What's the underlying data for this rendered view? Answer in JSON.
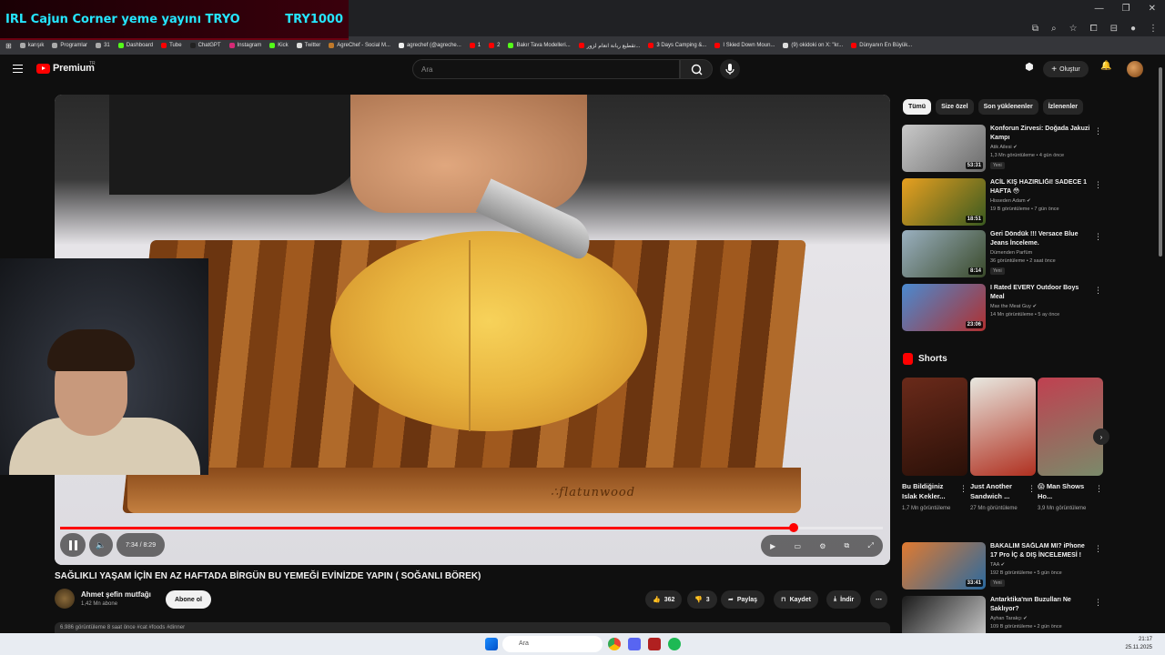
{
  "stream": {
    "left": "IRL Cajun Corner yeme yayını  TRYO",
    "right": "TRY1000"
  },
  "bookmarks": [
    {
      "label": "karışık",
      "color": "#aaa"
    },
    {
      "label": "Programlar",
      "color": "#aaa"
    },
    {
      "label": "31",
      "color": "#aaa"
    },
    {
      "label": "Dashboard",
      "color": "#53fc18"
    },
    {
      "label": "Tube",
      "color": "#f00"
    },
    {
      "label": "ChatGPT",
      "color": "#222"
    },
    {
      "label": "Instagram",
      "color": "#d62976"
    },
    {
      "label": "Kick",
      "color": "#53fc18"
    },
    {
      "label": "Twitter",
      "color": "#ddd"
    },
    {
      "label": "AgreChef - Social M...",
      "color": "#c0792a"
    },
    {
      "label": "agrechef (@agreche...",
      "color": "#eee"
    },
    {
      "label": "1",
      "color": "#f00"
    },
    {
      "label": "2",
      "color": "#f00"
    },
    {
      "label": "Bakır Tava Modelleri...",
      "color": "#53fc18"
    },
    {
      "label": "تقطيع ربانة انعام لزور...",
      "color": "#f00"
    },
    {
      "label": "3 Days Camping &...",
      "color": "#f00"
    },
    {
      "label": "I Skied Down Moun...",
      "color": "#f00"
    },
    {
      "label": "(9) okidoki on X: \"kr...",
      "color": "#ddd"
    },
    {
      "label": "Dünyanın En Büyük...",
      "color": "#f00"
    }
  ],
  "header": {
    "logo": "Premium",
    "region": "TR",
    "search_placeholder": "Ara",
    "create": "Oluştur"
  },
  "player": {
    "time": "7:34 / 8:29",
    "progress": 0.892,
    "brand": "∴flatunwood"
  },
  "video": {
    "title": "SAĞLIKLI YAŞAM İÇİN EN AZ HAFTADA BİRGÜN BU YEMEĞİ EVİNİZDE YAPIN ( SOĞANLI BÖREK)",
    "channel": "Ahmet şefin mutfağı",
    "subs": "1,42 Mn abone",
    "subscribe": "Abone ol",
    "likes": "362",
    "dislikes": "3",
    "share": "Paylaş",
    "save": "Kaydet",
    "download": "İndir",
    "desc": "6.986 görüntüleme  8 saat önce  #cat #foods #dinner"
  },
  "chips": [
    "Tümü",
    "Size özel",
    "Son yüklenenler",
    "İzlenenler"
  ],
  "recommended": [
    {
      "title": "Konforun Zirvesi: Doğada Jakuzi Kampı",
      "channel": "Atik Ailesi ✔",
      "meta": "1,3 Mn görüntüleme • 4 gün önce",
      "badge": "Yeni",
      "dur": "53:31",
      "color1": "#c9c9c9",
      "color2": "#6b6b6b"
    },
    {
      "title": "ACİL KIŞ HAZIRLIĞI! SADECE 1 HAFTA 😳",
      "channel": "Hisseden Adam ✔",
      "meta": "19 B görüntüleme • 7 gün önce",
      "badge": "",
      "dur": "18:51",
      "color1": "#e8a020",
      "color2": "#3a5a20"
    },
    {
      "title": "Geri Döndük !!! Versace Blue Jeans İnceleme.",
      "channel": "Dümenden Parfüm",
      "meta": "36 görüntüleme • 2 saat önce",
      "badge": "Yeni",
      "dur": "8:14",
      "color1": "#9ab0c0",
      "color2": "#3a4a2a"
    },
    {
      "title": "I Rated EVERY Outdoor Boys Meal",
      "channel": "Max the Meat Guy ✔",
      "meta": "14 Mn görüntüleme • 5 ay önce",
      "badge": "",
      "dur": "23:06",
      "color1": "#4a8ad0",
      "color2": "#b03030"
    },
    {
      "title": "BAKALIM SAĞLAM MI? iPhone 17 Pro İÇ & DIŞ İNCELEMESİ !",
      "channel": "TAA ✔",
      "meta": "192 B görüntüleme • 5 gün önce",
      "badge": "Yeni",
      "dur": "33:41",
      "color1": "#e07a30",
      "color2": "#2a6aa0"
    },
    {
      "title": "Antarktika'nın Buzulları Ne Saklıyor?",
      "channel": "Ayhan Tarakçı ✔",
      "meta": "109 B görüntüleme • 2 gün önce",
      "badge": "",
      "dur": "",
      "color1": "#1a1a1a",
      "color2": "#d0d0d0"
    }
  ],
  "shorts_title": "Shorts",
  "shorts": [
    {
      "label": "Bu Bildiğiniz Islak Kekler...",
      "views": "1,7 Mn görüntüleme",
      "c1": "#6a2a1a",
      "c2": "#2a1008"
    },
    {
      "label": "Just Another Sandwich ...",
      "views": "27 Mn görüntüleme",
      "c1": "#e8e8e0",
      "c2": "#b03020"
    },
    {
      "label": "😱 Man Shows Ho...",
      "views": "3,9 Mn görüntüleme",
      "c1": "#c04050",
      "c2": "#7a8a6a"
    }
  ],
  "taskbar": {
    "search": "Ara",
    "time": "21:17",
    "date": "25.11.2025"
  }
}
